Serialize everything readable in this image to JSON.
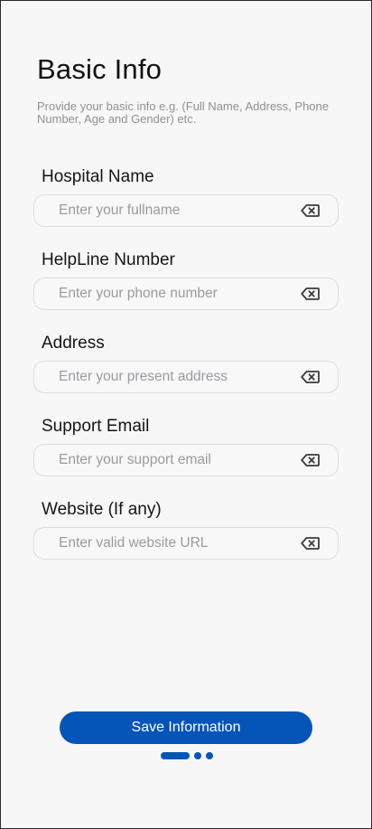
{
  "header": {
    "title": "Basic Info",
    "subtitle": "Provide your basic info e.g. (Full Name, Address, Phone Number, Age and Gender) etc."
  },
  "form": {
    "fields": [
      {
        "label": "Hospital Name",
        "placeholder": "Enter your fullname",
        "value": ""
      },
      {
        "label": "HelpLine Number",
        "placeholder": "Enter your phone number",
        "value": ""
      },
      {
        "label": "Address",
        "placeholder": "Enter your present address",
        "value": ""
      },
      {
        "label": "Support Email",
        "placeholder": "Enter your support email",
        "value": ""
      },
      {
        "label": "Website (If any)",
        "placeholder": "Enter valid website URL",
        "value": ""
      }
    ],
    "clear_icon": "backspace-clear-icon"
  },
  "footer": {
    "save_label": "Save Information",
    "pager": {
      "total": 3,
      "current": 1
    }
  },
  "colors": {
    "primary": "#0554b8",
    "background": "#f7f7f8",
    "input_border": "#dcdcdf",
    "placeholder": "#9a9aa0",
    "subtitle": "#8f8f96"
  }
}
